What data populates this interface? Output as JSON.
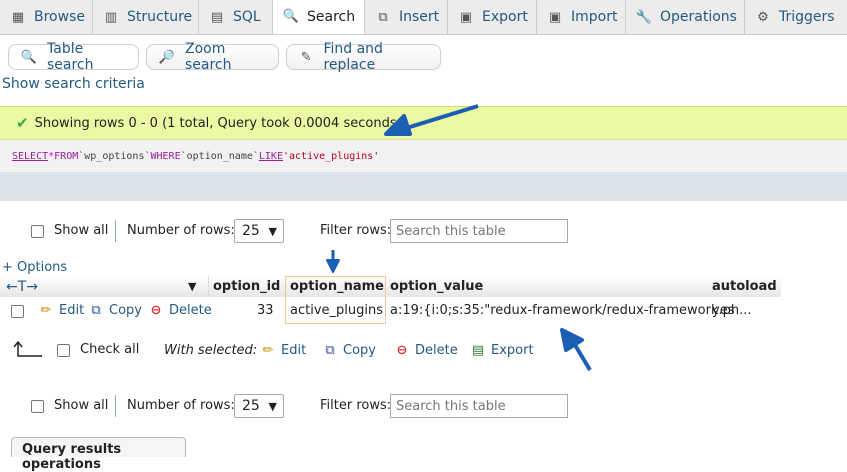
{
  "tabs": [
    {
      "label": "Browse",
      "icon": "browse-icon"
    },
    {
      "label": "Structure",
      "icon": "structure-icon"
    },
    {
      "label": "SQL",
      "icon": "sql-icon"
    },
    {
      "label": "Search",
      "icon": "search-icon",
      "active": true
    },
    {
      "label": "Insert",
      "icon": "insert-icon"
    },
    {
      "label": "Export",
      "icon": "export-icon"
    },
    {
      "label": "Import",
      "icon": "import-icon"
    },
    {
      "label": "Operations",
      "icon": "wrench-icon"
    },
    {
      "label": "Triggers",
      "icon": "triggers-icon"
    }
  ],
  "subtabs": {
    "table_search": "Table search",
    "zoom_search": "Zoom search",
    "find_replace": "Find and replace"
  },
  "show_criteria": "Show search criteria",
  "result": {
    "message": "Showing rows 0 - 0 (1 total, Query took 0.0004 seconds.)",
    "sql": {
      "k1": "SELECT",
      "star": "*",
      "k2": "FROM",
      "table": "`wp_options`",
      "k3": "WHERE",
      "col": "`option_name`",
      "k4": "LIKE",
      "val": "'active_plugins'"
    }
  },
  "nav": {
    "show_all": "Show all",
    "num_rows_label": "Number of rows:",
    "num_rows_value": "25",
    "filter_label": "Filter rows:",
    "filter_placeholder": "Search this table"
  },
  "options_link": "+ Options",
  "table": {
    "col_arrows": "←T→",
    "headers": [
      "option_id",
      "option_name",
      "option_value",
      "autoload"
    ],
    "row": {
      "edit": "Edit",
      "copy": "Copy",
      "delete": "Delete",
      "option_id": "33",
      "option_name": "active_plugins",
      "option_value": "a:19:{i:0;s:35:\"redux-framework/redux-framework.ph...",
      "autoload": "yes"
    }
  },
  "bulk": {
    "check_all": "Check all",
    "with_selected": "With selected:",
    "edit": "Edit",
    "copy": "Copy",
    "delete": "Delete",
    "export": "Export"
  },
  "query_results_ops": "Query results operations",
  "colors": {
    "link": "#235a81",
    "success_bg": "#ebf8a4",
    "annotation_arrow": "#1a5fb4"
  }
}
